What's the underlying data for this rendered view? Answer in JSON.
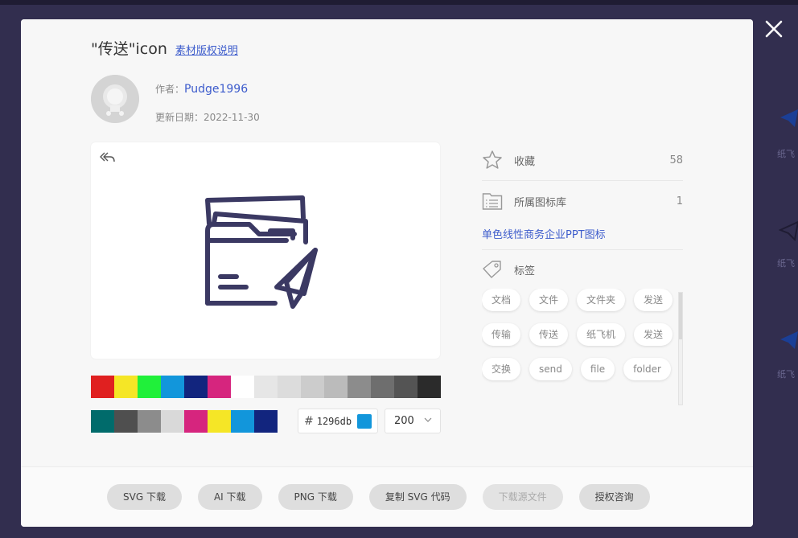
{
  "modal": {
    "title": "\"传送\"icon",
    "license_link": "素材版权说明",
    "author_label": "作者：",
    "author_name": "Pudge1996",
    "date_label": "更新日期：",
    "date": "2022-11-30"
  },
  "preview": {
    "back_icon": "undo-arrow-icon",
    "icon_name": "folder-paper-plane-icon",
    "icon_color": "#3b3963"
  },
  "palette": {
    "row1": [
      "#e02020",
      "#f5e626",
      "#20f03a",
      "#1296db",
      "#12257e",
      "#d6257e",
      "#ffffff",
      "#e6e6e6",
      "#dcdcdc",
      "#cccccc",
      "#bbbbbb",
      "#8c8c8c",
      "#6e6e6e",
      "#545454",
      "#2b2b2b"
    ],
    "row2": [
      "#006b6b",
      "#4f4f4f",
      "#8c8c8c",
      "#d9d9d9",
      "#d6257e",
      "#f5e626",
      "#1296db",
      "#12257e"
    ]
  },
  "color_input": {
    "hash": "#",
    "value": "1296db",
    "swatch": "#1296db"
  },
  "size_select": {
    "value": "200"
  },
  "stats": {
    "favorite_label": "收藏",
    "favorite_count": "58",
    "library_label": "所属图标库",
    "library_count": "1",
    "library_name": "单色线性商务企业PPT图标",
    "tags_label": "标签"
  },
  "tags": [
    "文档",
    "文件",
    "文件夹",
    "发送",
    "传输",
    "传送",
    "纸飞机",
    "发送",
    "交换",
    "send",
    "file",
    "folder"
  ],
  "actions": {
    "svg_download": "SVG 下载",
    "ai_download": "AI 下载",
    "png_download": "PNG 下载",
    "copy_svg": "复制 SVG 代码",
    "source_download": "下载源文件",
    "license_consult": "授权咨询"
  },
  "background": {
    "side_label_1": "纸飞",
    "side_label_2": "纸飞",
    "side_label_3": "纸飞"
  }
}
